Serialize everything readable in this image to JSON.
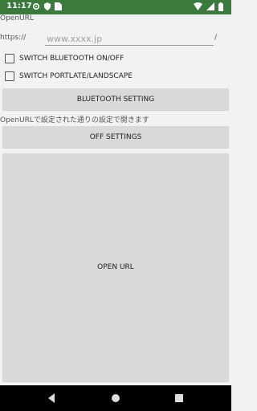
{
  "status_bar": {
    "time": "11:17"
  },
  "app": {
    "name": "OpenURL"
  },
  "url": {
    "prefix": "https://",
    "placeholder": "www.xxxx.jp",
    "suffix": "/"
  },
  "checkboxes": [
    {
      "label": "SWITCH BLUETOOTH ON/OFF",
      "checked": false
    },
    {
      "label": "SWITCH PORTLATE/LANDSCAPE",
      "checked": false
    }
  ],
  "buttons": {
    "bluetooth": "BLUETOOTH SETTING",
    "off": "OFF SETTINGS",
    "open": "OPEN URL"
  },
  "info": "OpenURLで設定された通りの設定で開きます"
}
